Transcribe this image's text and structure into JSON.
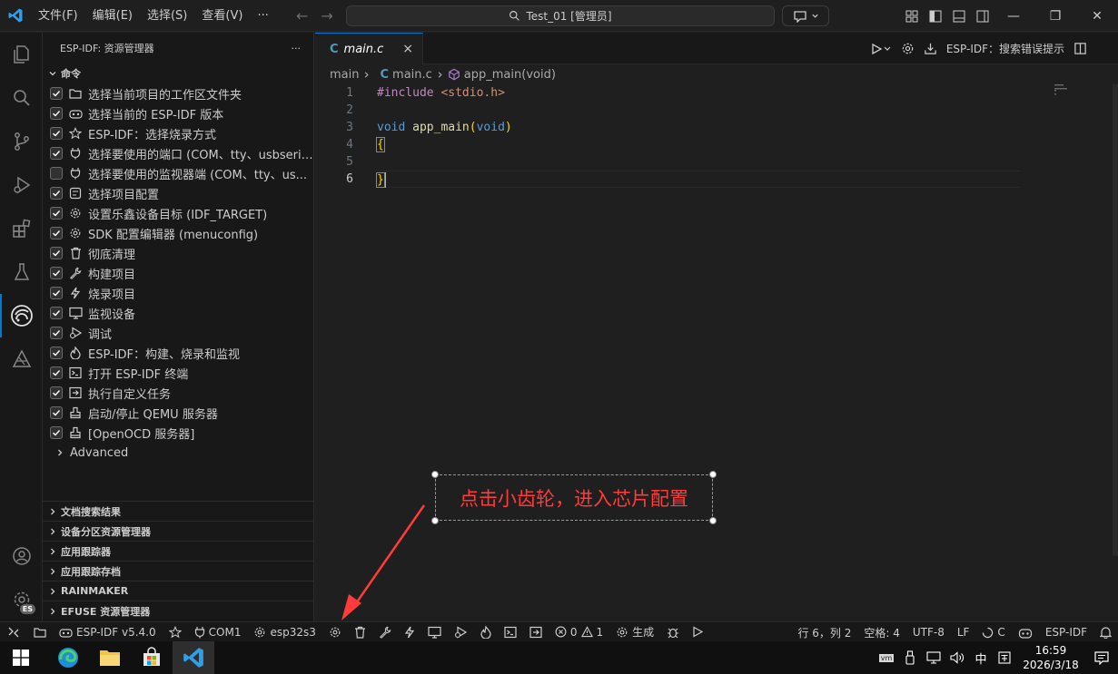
{
  "titlebar": {
    "menus": [
      "文件(F)",
      "编辑(E)",
      "选择(S)",
      "查看(V)"
    ],
    "more": "···",
    "search": "Test_01 [管理员]"
  },
  "sidebar": {
    "title": "ESP-IDF: 资源管理器",
    "more": "···",
    "section": "命令",
    "items": [
      {
        "label": "选择当前项目的工作区文件夹",
        "checked": true,
        "icon": "folder-icon"
      },
      {
        "label": "选择当前的 ESP-IDF 版本",
        "checked": true,
        "icon": "esp-idf-icon"
      },
      {
        "label": "ESP-IDF：选择烧录方式",
        "checked": true,
        "icon": "star-icon"
      },
      {
        "label": "选择要使用的端口 (COM、tty、usbserial)",
        "checked": true,
        "icon": "plug-icon"
      },
      {
        "label": "选择要使用的监视器端 (COM、tty、us...",
        "checked": false,
        "icon": "plug-icon"
      },
      {
        "label": "选择项目配置",
        "checked": true,
        "icon": "config-icon"
      },
      {
        "label": "设置乐鑫设备目标 (IDF_TARGET)",
        "checked": true,
        "icon": "chip-gear-icon"
      },
      {
        "label": "SDK 配置编辑器 (menuconfig)",
        "checked": true,
        "icon": "gear-icon"
      },
      {
        "label": "彻底清理",
        "checked": true,
        "icon": "trash-icon"
      },
      {
        "label": "构建项目",
        "checked": true,
        "icon": "wrench-icon"
      },
      {
        "label": "烧录项目",
        "checked": true,
        "icon": "lightning-icon"
      },
      {
        "label": "监视设备",
        "checked": true,
        "icon": "monitor-icon"
      },
      {
        "label": "调试",
        "checked": true,
        "icon": "debug-icon"
      },
      {
        "label": "ESP-IDF：构建、烧录和监视",
        "checked": true,
        "icon": "flame-icon"
      },
      {
        "label": "打开 ESP-IDF 终端",
        "checked": true,
        "icon": "terminal-icon"
      },
      {
        "label": "执行自定义任务",
        "checked": true,
        "icon": "run-task-icon"
      },
      {
        "label": "启动/停止 QEMU 服务器",
        "checked": true,
        "icon": "server-icon"
      },
      {
        "label": "[OpenOCD 服务器]",
        "checked": true,
        "icon": "server-icon"
      }
    ],
    "advanced": "Advanced",
    "collapsed": [
      "文档搜索结果",
      "设备分区资源管理器",
      "应用跟踪器",
      "应用跟踪存档",
      "RAINMAKER",
      "EFUSE 资源管理器"
    ]
  },
  "editor": {
    "tab": {
      "lang": "C",
      "name": "main.c",
      "close": "×"
    },
    "actions_label": "ESP-IDF：搜索错误提示",
    "breadcrumb": {
      "folder": "main",
      "file_lang": "C",
      "file": "main.c",
      "symbol": "app_main(void)"
    },
    "line_numbers": [
      "1",
      "2",
      "3",
      "4",
      "5",
      "6"
    ],
    "code": {
      "line1_directive": "#include",
      "line1_header": "<stdio.h>",
      "line3_type": "void",
      "line3_fn": "app_main",
      "line3_paren_open": "(",
      "line3_param": "void",
      "line3_paren_close": ")",
      "line4": "{",
      "line6": "}"
    }
  },
  "annotation": {
    "text": "点击小齿轮，进入芯片配置",
    "color": "#ff3b3b"
  },
  "statusbar": {
    "idf_version": "ESP-IDF v5.4.0",
    "port": "COM1",
    "target": "esp32s3",
    "errors": "0",
    "warnings": "1",
    "build": "生成",
    "position": "行 6，列 2",
    "spaces": "空格: 4",
    "encoding": "UTF-8",
    "eol": "LF",
    "language": "C",
    "esp_label": "ESP-IDF"
  },
  "taskbar": {
    "ime": "中",
    "time": "16:59",
    "date": "2026/3/18",
    "vm": "vm"
  },
  "colors": {
    "accent": "#0078d4",
    "background": "#1f1f1f",
    "sidebar": "#181818"
  }
}
